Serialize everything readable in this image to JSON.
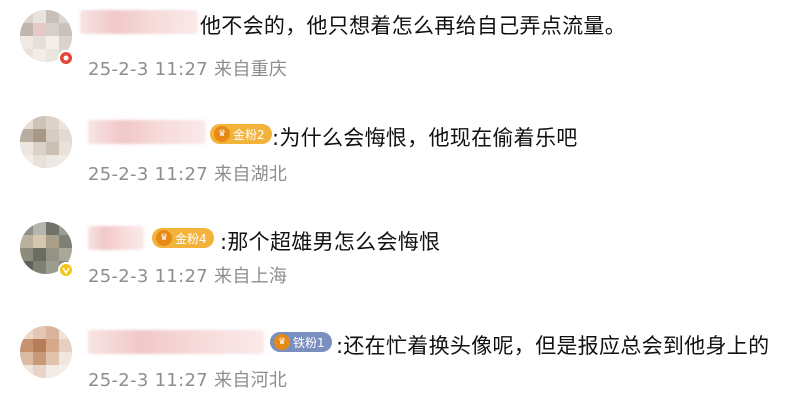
{
  "comments": [
    {
      "fan_badge": "",
      "text": "他不会的，他只想着怎么再给自己弄点流量。",
      "time": "25-2-3 11:27",
      "location": "来自重庆"
    },
    {
      "fan_badge": "金粉2",
      "text": ":为什么会悔恨，他现在偷着乐吧",
      "time": "25-2-3 11:27",
      "location": "来自湖北"
    },
    {
      "fan_badge": "金粉4",
      "text": ":那个超雄男怎么会悔恨",
      "time": "25-2-3 11:27",
      "location": "来自上海"
    },
    {
      "fan_badge": "铁粉1",
      "text": ":还在忙着换头像呢，但是报应总会到他身上的",
      "time": "25-2-3 11:27",
      "location": "来自河北"
    }
  ],
  "colors": {
    "gold_badge": "#f3b23a",
    "iron_badge": "#7a8fbf",
    "meta_text": "#8e8e8e",
    "verified_dot": "#f5c518",
    "red_dot": "#e0463a"
  },
  "icons": [
    "red-badge-icon",
    "fan-level-icon",
    "verified-icon"
  ]
}
